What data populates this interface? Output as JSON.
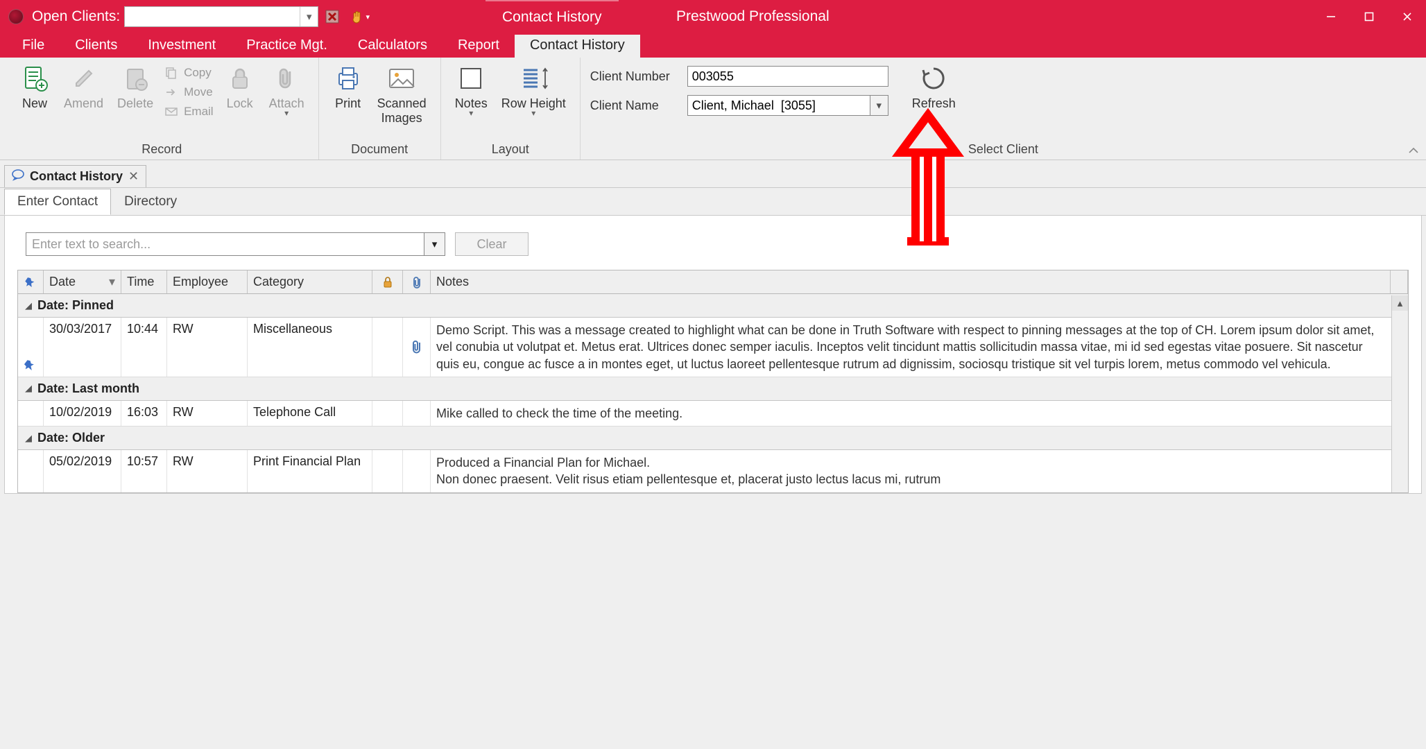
{
  "titlebar": {
    "open_clients_label": "Open Clients:",
    "center_tab": "Contact History",
    "app_name": "Prestwood Professional"
  },
  "menu": {
    "items": [
      "File",
      "Clients",
      "Investment",
      "Practice Mgt.",
      "Calculators",
      "Report",
      "Contact History"
    ],
    "active_index": 6
  },
  "ribbon": {
    "groups": {
      "record": {
        "label": "Record",
        "new": "New",
        "amend": "Amend",
        "delete": "Delete",
        "copy": "Copy",
        "move": "Move",
        "email": "Email",
        "lock": "Lock",
        "attach": "Attach"
      },
      "document": {
        "label": "Document",
        "print": "Print",
        "scanned": "Scanned\nImages"
      },
      "layout": {
        "label": "Layout",
        "notes": "Notes",
        "rowheight": "Row Height"
      },
      "select_client": {
        "label": "Select Client",
        "cn_label": "Client Number",
        "cn_value": "003055",
        "name_label": "Client Name",
        "name_value": "Client, Michael  [3055]",
        "refresh": "Refresh"
      }
    }
  },
  "doctab": {
    "title": "Contact History"
  },
  "subtabs": {
    "items": [
      "Enter Contact",
      "Directory"
    ],
    "active_index": 0
  },
  "search": {
    "placeholder": "Enter text to search...",
    "clear": "Clear"
  },
  "grid": {
    "headers": {
      "date": "Date",
      "time": "Time",
      "employee": "Employee",
      "category": "Category",
      "notes": "Notes"
    },
    "groups": [
      {
        "label": "Date: Pinned",
        "rows": [
          {
            "pinned": true,
            "date": "30/03/2017",
            "time": "10:44",
            "employee": "RW",
            "category": "Miscellaneous",
            "has_attachment": true,
            "notes": "Demo Script. This was a message created to highlight what can be done in Truth Software with respect to pinning messages at the top of CH. Lorem ipsum dolor sit amet, vel conubia ut volutpat et. Metus erat. Ultrices donec semper iaculis. Inceptos velit tincidunt mattis sollicitudin massa vitae, mi id sed egestas vitae posuere. Sit nascetur quis eu, congue ac fusce a in montes eget, ut luctus laoreet pellentesque rutrum ad dignissim, sociosqu tristique sit vel turpis lorem, metus commodo vel vehicula."
          }
        ]
      },
      {
        "label": "Date: Last month",
        "rows": [
          {
            "pinned": false,
            "date": "10/02/2019",
            "time": "16:03",
            "employee": "RW",
            "category": "Telephone Call",
            "has_attachment": false,
            "notes": "Mike called to check the time of the meeting."
          }
        ]
      },
      {
        "label": "Date: Older",
        "rows": [
          {
            "pinned": false,
            "date": "05/02/2019",
            "time": "10:57",
            "employee": "RW",
            "category": "Print Financial Plan",
            "has_attachment": false,
            "notes": "Produced a Financial Plan for Michael.\nNon donec praesent. Velit risus etiam pellentesque et, placerat justo lectus lacus mi, rutrum"
          }
        ]
      }
    ]
  }
}
